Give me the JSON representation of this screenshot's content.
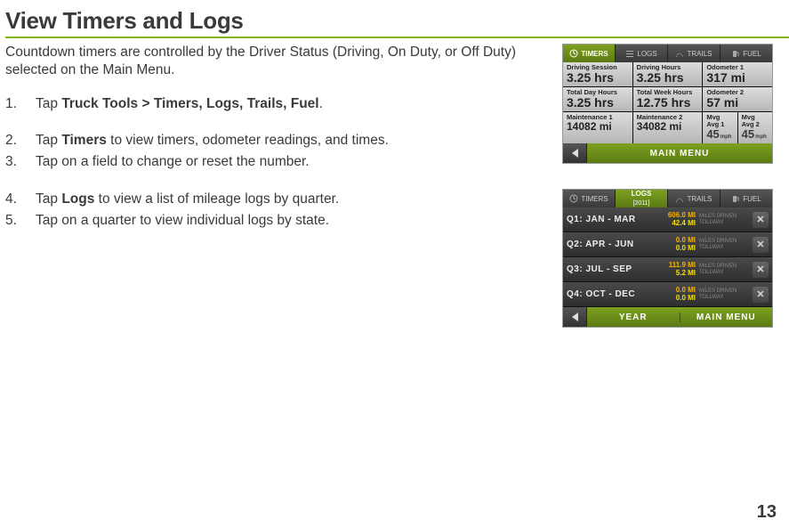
{
  "title": "View Timers and Logs",
  "intro": "Countdown timers are controlled by the Driver Status (Driving, On Duty, or Off Duty) selected on the Main Menu.",
  "steps": {
    "s1a": "Tap ",
    "s1b": "Truck Tools > Timers, Logs, Trails, Fuel",
    "s1c": ".",
    "s2a": "Tap ",
    "s2b": "Timers",
    "s2c": " to view timers, odometer readings, and times.",
    "s3": "Tap on a field to change or reset the number.",
    "s4a": "Tap ",
    "s4b": "Logs",
    "s4c": " to view a list of mileage logs by quarter.",
    "s5": "Tap on a quarter to view individual logs by state."
  },
  "dev1": {
    "tabs": {
      "t1": "TIMERS",
      "t2": "LOGS",
      "t3": "TRAILS",
      "t4": "FUEL"
    },
    "cells": {
      "c1l": "Driving Session",
      "c1v": "3.25 hrs",
      "c2l": "Driving Hours",
      "c2v": "3.25 hrs",
      "c3l": "Odometer 1",
      "c3v": "317 mi",
      "c4l": "Total Day Hours",
      "c4v": "3.25 hrs",
      "c5l": "Total Week Hours",
      "c5v": "12.75 hrs",
      "c6l": "Odometer 2",
      "c6v": "57 mi",
      "c7l": "Maintenance 1",
      "c7v": "14082 mi",
      "c8l": "Maintenance 2",
      "c8v": "34082 mi",
      "c9l": "Mvg Avg 1",
      "c9n": "45",
      "c9u": "mph",
      "c10l": "Mvg Avg 2",
      "c10n": "45",
      "c10u": "mph"
    },
    "menu": "MAIN MENU"
  },
  "dev2": {
    "tabs": {
      "t1": "TIMERS",
      "t2a": "LOGS",
      "t2b": "[2011]",
      "t3": "TRAILS",
      "t4": "FUEL"
    },
    "rows": {
      "r1q": "Q1: JAN - MAR",
      "r1a": "606.0 MI",
      "r1b": "42.4 MI",
      "r2q": "Q2: APR - JUN",
      "r2a": "0.0 MI",
      "r2b": "0.0 MI",
      "r3q": "Q3: JUL - SEP",
      "r3a": "111.9 MI",
      "r3b": "5.2 MI",
      "r4q": "Q4: OCT - DEC",
      "r4a": "0.0 MI",
      "r4b": "0.0 MI",
      "tagA": "MILES DRIVEN",
      "tagB": "TOLLWAY"
    },
    "menu": {
      "year": "YEAR",
      "main": "MAIN MENU"
    }
  },
  "pageNum": "13"
}
